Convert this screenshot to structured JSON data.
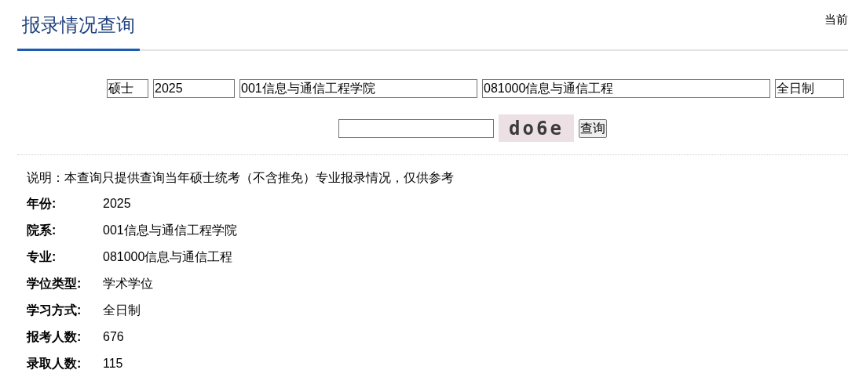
{
  "page_title": "报录情况查询",
  "corner_text": "当前",
  "filters": [
    {
      "value": "硕士"
    },
    {
      "value": "2025"
    },
    {
      "value": "001信息与通信工程学院"
    },
    {
      "value": "081000信息与通信工程"
    },
    {
      "value": "全日制"
    }
  ],
  "captcha": {
    "code": "do6e"
  },
  "query_button": "查询",
  "note": "说明：本查询只提供查询当年硕士统考（不含推免）专业报录情况，仅供参考",
  "results": [
    {
      "label": "年份:",
      "value": "2025"
    },
    {
      "label": "院系:",
      "value": "001信息与通信工程学院"
    },
    {
      "label": "专业:",
      "value": "081000信息与通信工程"
    },
    {
      "label": "学位类型:",
      "value": "学术学位"
    },
    {
      "label": "学习方式:",
      "value": "全日制"
    },
    {
      "label": "报考人数:",
      "value": "676"
    },
    {
      "label": "录取人数:",
      "value": "115"
    }
  ]
}
